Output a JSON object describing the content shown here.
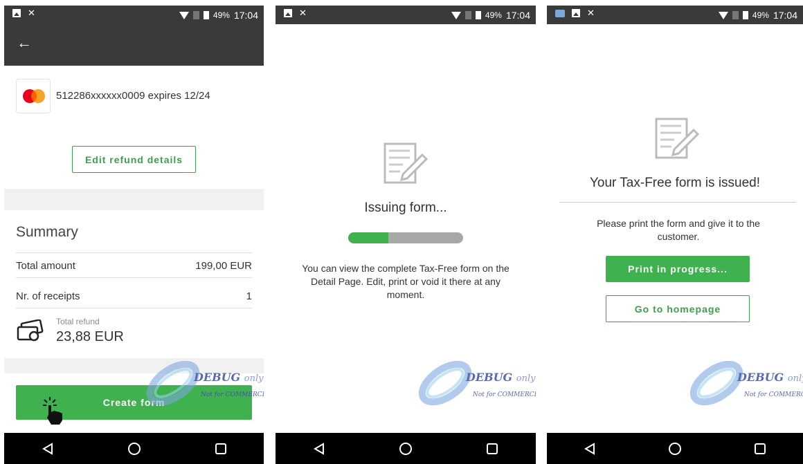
{
  "status_bar": {
    "battery": "49%",
    "time": "17:04"
  },
  "screen1": {
    "card_number": "512286xxxxxx0009",
    "card_expiry": "expires 12/24",
    "edit_button": "Edit refund details",
    "summary_title": "Summary",
    "total_amount_label": "Total amount",
    "total_amount_value": "199,00 EUR",
    "receipts_label": "Nr. of receipts",
    "receipts_value": "1",
    "total_refund_label": "Total refund",
    "total_refund_value": "23,88 EUR",
    "create_button": "Create form"
  },
  "screen2": {
    "title": "Issuing form...",
    "progress": 0.35,
    "description": "You can view the complete Tax-Free form on the Detail Page. Edit, print or void it there at any moment."
  },
  "screen3": {
    "title": "Your Tax-Free form is issued!",
    "message": "Please print the form and give it to the customer.",
    "print_button": "Print in progress...",
    "home_button": "Go to homepage"
  },
  "watermark": {
    "title": "DEBUG",
    "title_suffix": "only",
    "subtitle": "Not for COMMERCIAL"
  },
  "colors": {
    "accent": "#3fb14f",
    "statusbar": "#3a3a3a",
    "navbar": "#000000"
  }
}
